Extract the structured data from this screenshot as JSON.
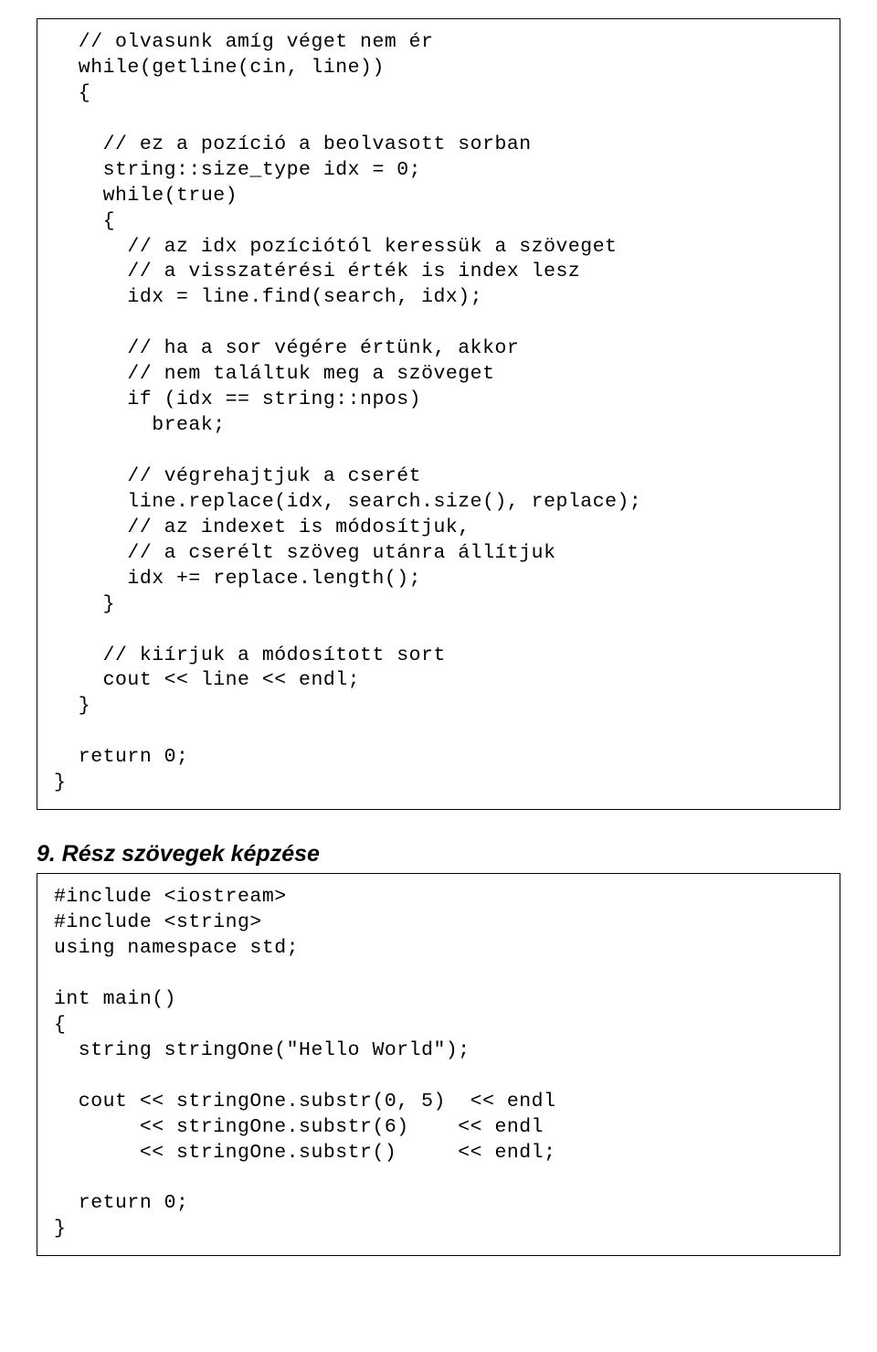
{
  "codebox1": {
    "text": "  // olvasunk amíg véget nem ér\n  while(getline(cin, line))\n  {\n\n    // ez a pozíció a beolvasott sorban\n    string::size_type idx = 0;\n    while(true)\n    {\n      // az idx pozíciótól keressük a szöveget\n      // a visszatérési érték is index lesz\n      idx = line.find(search, idx);\n\n      // ha a sor végére értünk, akkor\n      // nem találtuk meg a szöveget\n      if (idx == string::npos)\n        break;\n\n      // végrehajtjuk a cserét\n      line.replace(idx, search.size(), replace);\n      // az indexet is módosítjuk,\n      // a cserélt szöveg utánra állítjuk\n      idx += replace.length();\n    }\n\n    // kiírjuk a módosított sort\n    cout << line << endl;\n  }\n\n  return 0;\n}"
  },
  "heading": {
    "text": "9. Rész szövegek képzése"
  },
  "codebox2": {
    "text": "#include <iostream>\n#include <string>\nusing namespace std;\n\nint main()\n{\n  string stringOne(\"Hello World\");\n\n  cout << stringOne.substr(0, 5)  << endl\n       << stringOne.substr(6)    << endl\n       << stringOne.substr()     << endl;\n\n  return 0;\n}"
  }
}
